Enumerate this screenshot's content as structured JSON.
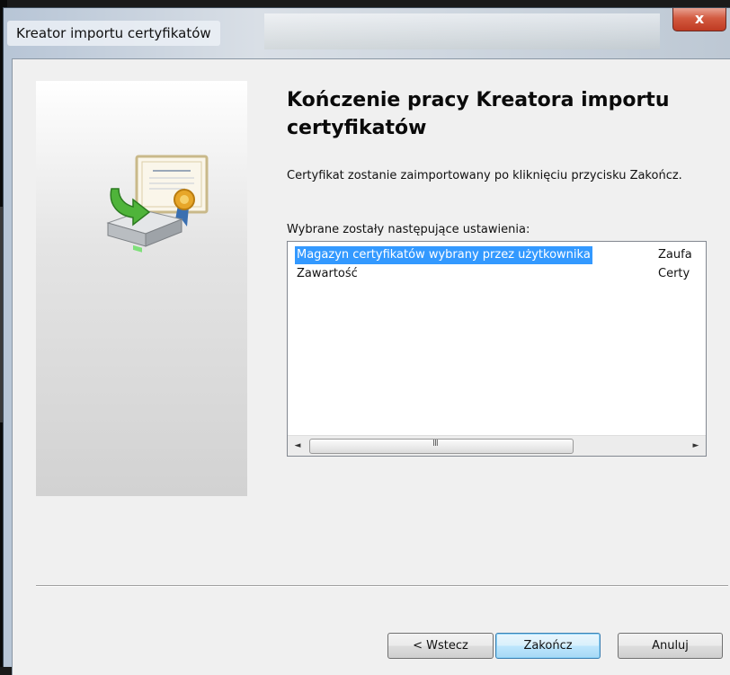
{
  "window": {
    "title": "Kreator importu certyfikatów",
    "close_label": "x"
  },
  "page": {
    "heading": "Kończenie pracy Kreatora importu certyfikatów",
    "description": "Certyfikat zostanie zaimportowany po kliknięciu przycisku Zakończ.",
    "list_label": "Wybrane zostały następujące ustawienia:"
  },
  "settings": {
    "rows": [
      {
        "name": "Magazyn certyfikatów wybrany przez użytkownika",
        "value": "Zaufa",
        "selected": true
      },
      {
        "name": "Zawartość",
        "value": "Certy",
        "selected": false
      }
    ]
  },
  "scrollbar": {
    "left_arrow": "◄",
    "right_arrow": "►",
    "grip": "III"
  },
  "buttons": {
    "back": "< Wstecz",
    "finish": "Zakończ",
    "cancel": "Anuluj"
  },
  "colors": {
    "selection": "#3399ff",
    "close_button": "#c9452a"
  },
  "icons": {
    "wizard_art": "certificate-import-icon"
  }
}
